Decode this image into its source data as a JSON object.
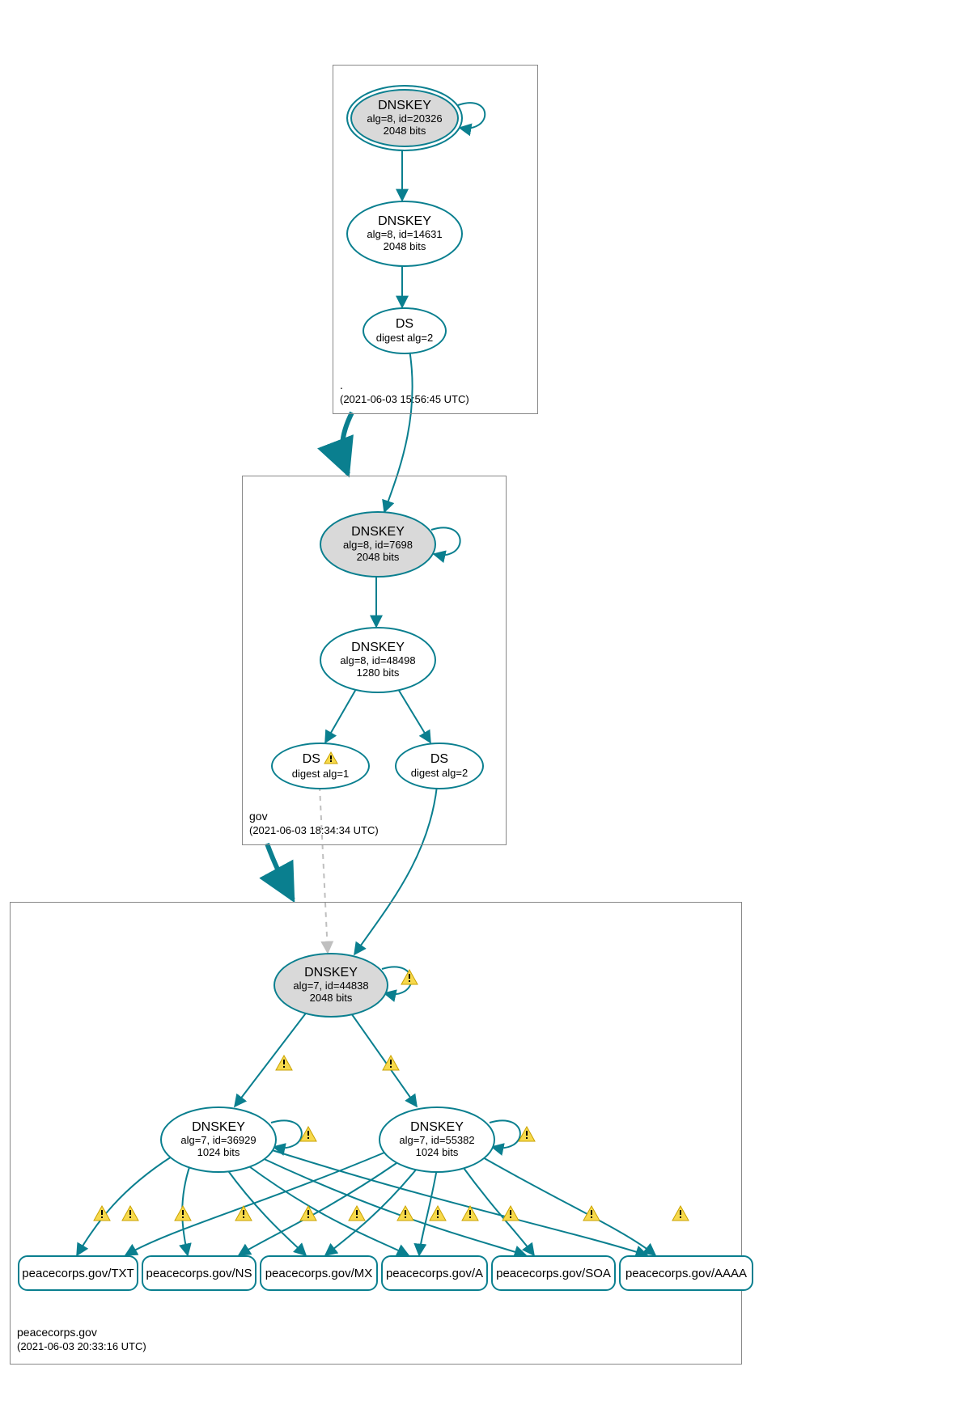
{
  "zones": {
    "root": {
      "name": ".",
      "timestamp": "(2021-06-03 15:56:45 UTC)"
    },
    "gov": {
      "name": "gov",
      "timestamp": "(2021-06-03 18:34:34 UTC)"
    },
    "pc": {
      "name": "peacecorps.gov",
      "timestamp": "(2021-06-03 20:33:16 UTC)"
    }
  },
  "nodes": {
    "root_ksk": {
      "title": "DNSKEY",
      "line2": "alg=8, id=20326",
      "line3": "2048 bits"
    },
    "root_zsk": {
      "title": "DNSKEY",
      "line2": "alg=8, id=14631",
      "line3": "2048 bits"
    },
    "root_ds": {
      "title": "DS",
      "line2": "digest alg=2"
    },
    "gov_ksk": {
      "title": "DNSKEY",
      "line2": "alg=8, id=7698",
      "line3": "2048 bits"
    },
    "gov_zsk": {
      "title": "DNSKEY",
      "line2": "alg=8, id=48498",
      "line3": "1280 bits"
    },
    "gov_ds1": {
      "title": "DS",
      "line2": "digest alg=1"
    },
    "gov_ds2": {
      "title": "DS",
      "line2": "digest alg=2"
    },
    "pc_ksk": {
      "title": "DNSKEY",
      "line2": "alg=7, id=44838",
      "line3": "2048 bits"
    },
    "pc_zsk1": {
      "title": "DNSKEY",
      "line2": "alg=7, id=36929",
      "line3": "1024 bits"
    },
    "pc_zsk2": {
      "title": "DNSKEY",
      "line2": "alg=7, id=55382",
      "line3": "1024 bits"
    }
  },
  "rr": {
    "txt": "peacecorps.gov/TXT",
    "ns": "peacecorps.gov/NS",
    "mx": "peacecorps.gov/MX",
    "a": "peacecorps.gov/A",
    "soa": "peacecorps.gov/SOA",
    "aaaa": "peacecorps.gov/AAAA"
  },
  "colors": {
    "stroke": "#0a7f8f",
    "warn_fill": "#f7d94c",
    "warn_edge": "#c9a200"
  }
}
